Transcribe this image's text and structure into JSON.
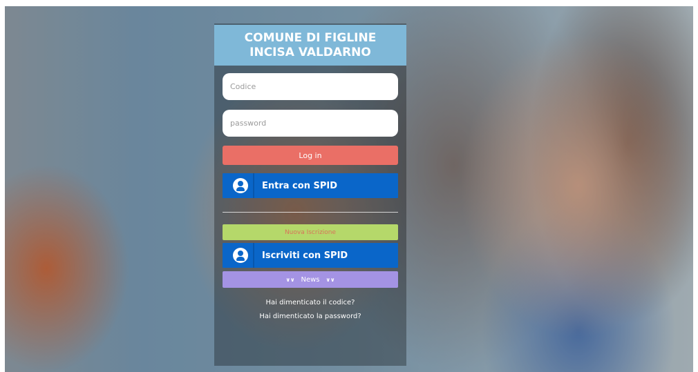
{
  "header": {
    "title": "COMUNE DI FIGLINE INCISA VALDARNO"
  },
  "login_form": {
    "code_placeholder": "Codice",
    "password_placeholder": "password",
    "login_label": "Log in",
    "spid_login_label": "Entra con SPID"
  },
  "registration": {
    "new_label": "Nuova Iscrizione",
    "spid_register_label": "Iscriviti con SPID"
  },
  "news": {
    "label": "News",
    "icon": "double-chevron-down-icon"
  },
  "links": {
    "forgot_code": "Hai dimenticato il codice?",
    "forgot_password": "Hai dimenticato la password?"
  },
  "colors": {
    "title_bg": "#7fb8d8",
    "login_button": "#ea6f66",
    "spid_button": "#0a66c9",
    "new_registration": "#b5d86a",
    "news_button": "#a493e4"
  }
}
